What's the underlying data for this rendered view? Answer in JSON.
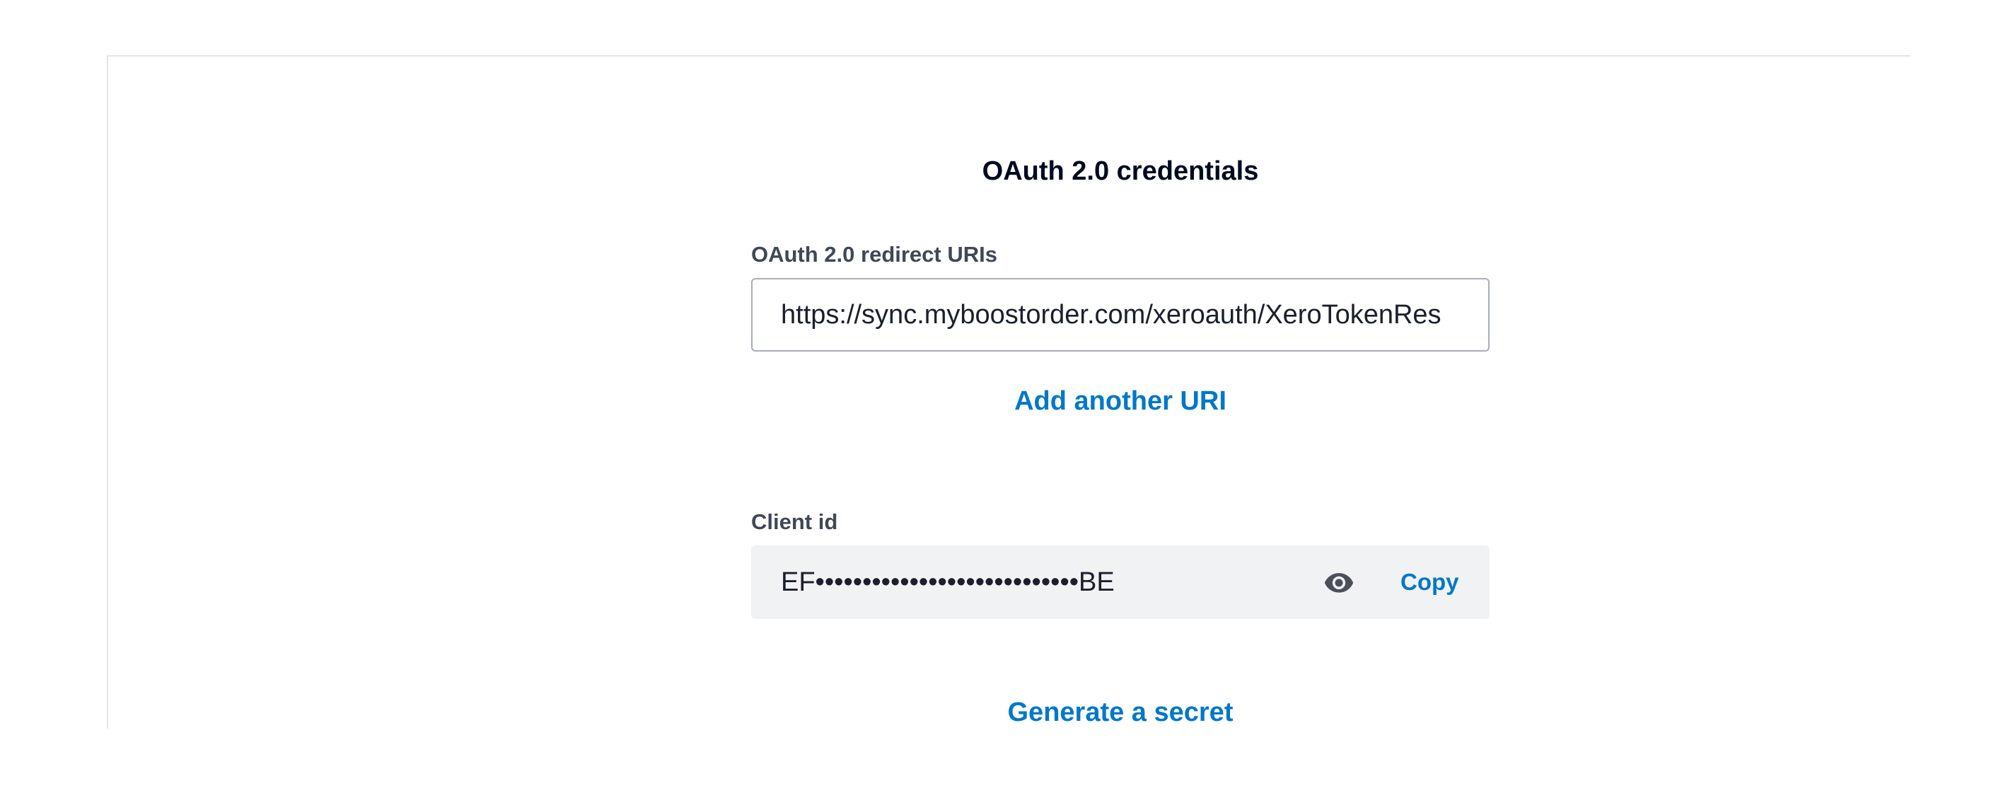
{
  "section": {
    "title": "OAuth 2.0 credentials"
  },
  "redirect_uris": {
    "label": "OAuth 2.0 redirect URIs",
    "value": "https://sync.myboostorder.com/xeroauth/XeroTokenRes",
    "add_link": "Add another URI"
  },
  "client_id": {
    "label": "Client id",
    "masked_value": "EF••••••••••••••••••••••••••••BE",
    "reveal_icon": "eye-icon",
    "copy_label": "Copy"
  },
  "generate_secret": {
    "label": "Generate a secret"
  },
  "colors": {
    "link": "#0078c8",
    "label": "#404756",
    "input_border": "#a8adb6",
    "readonly_bg": "#f1f2f4"
  }
}
